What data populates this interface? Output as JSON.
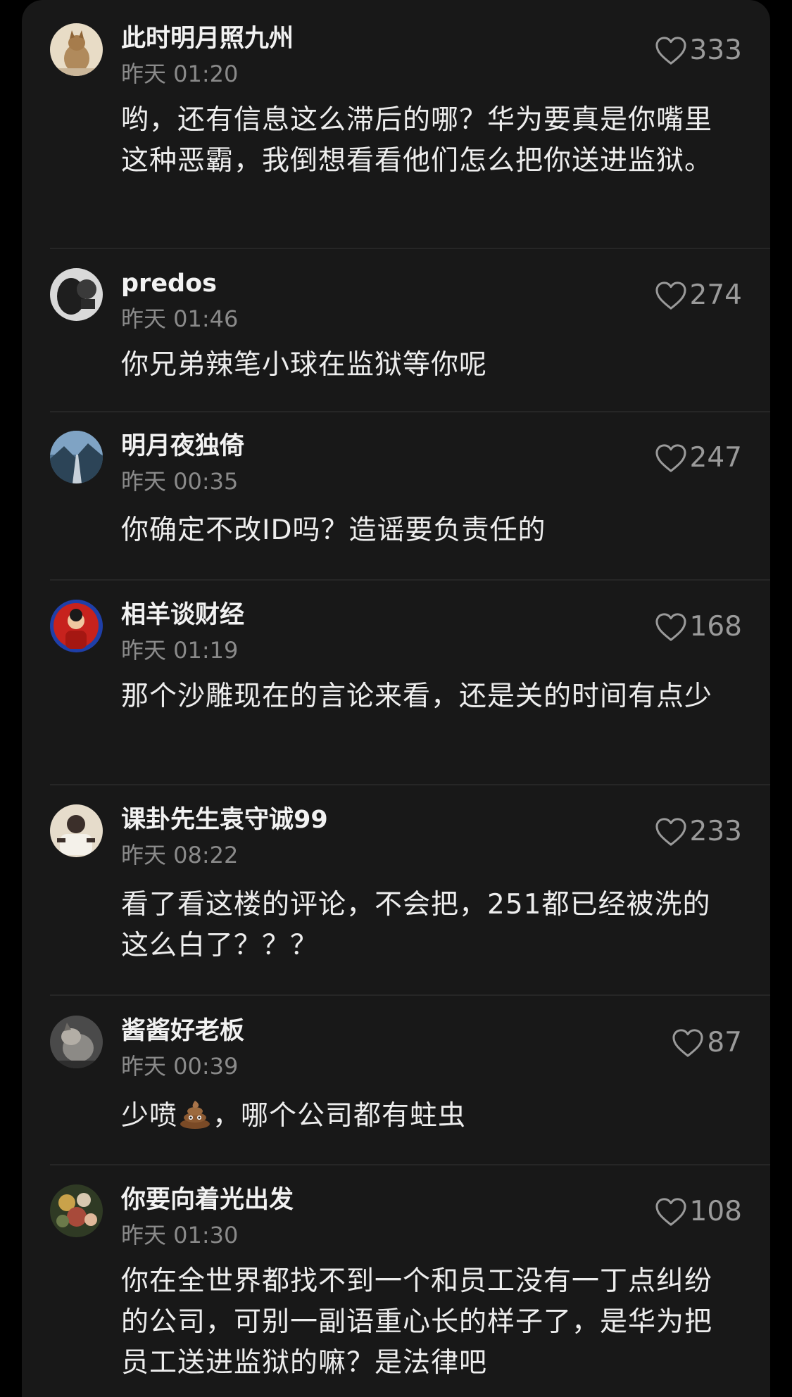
{
  "colors": {
    "background": "#000000",
    "panel": "#181818",
    "username": "#f2f2f2",
    "timestamp": "#8a8a8a",
    "text": "#ededed",
    "like": "#9a9a9a",
    "divider": "#262626"
  },
  "like_icon": "heart-outline-icon",
  "comments": [
    {
      "username": "此时明月照九州",
      "time": "昨天 01:20",
      "likes": "333",
      "text": "哟，还有信息这么滞后的哪？华为要真是你嘴里这种恶霸，我倒想看看他们怎么把你送进监狱。"
    },
    {
      "username": "predos",
      "time": "昨天 01:46",
      "likes": "274",
      "text": "你兄弟辣笔小球在监狱等你呢"
    },
    {
      "username": "明月夜独倚",
      "time": "昨天 00:35",
      "likes": "247",
      "text": "你确定不改ID吗？造谣要负责任的"
    },
    {
      "username": "相羊谈财经",
      "time": "昨天 01:19",
      "likes": "168",
      "text": "那个沙雕现在的言论来看，还是关的时间有点少"
    },
    {
      "username": "课卦先生袁守诚99",
      "time": "昨天 08:22",
      "likes": "233",
      "text": "看了看这楼的评论，不会把，251都已经被洗的这么白了？？？"
    },
    {
      "username": "酱酱好老板",
      "time": "昨天 00:39",
      "likes": "87",
      "text_before_emoji": "少喷",
      "emoji": "poop-emoji",
      "text_after_emoji": "，哪个公司都有蛀虫"
    },
    {
      "username": "你要向着光出发",
      "time": "昨天 01:30",
      "likes": "108",
      "text": "你在全世界都找不到一个和员工没有一丁点纠纷的公司，可别一副语重心长的样子了，是华为把员工送进监狱的嘛？是法律吧"
    }
  ]
}
